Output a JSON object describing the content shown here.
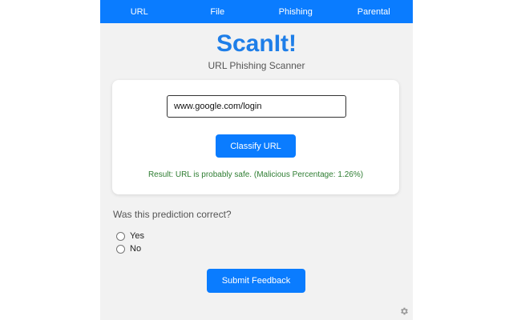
{
  "nav": {
    "items": [
      {
        "label": "URL"
      },
      {
        "label": "File"
      },
      {
        "label": "Phishing"
      },
      {
        "label": "Parental"
      }
    ]
  },
  "header": {
    "title": "ScanIt!",
    "subtitle": "URL Phishing Scanner"
  },
  "scanner": {
    "url_value": "www.google.com/login",
    "classify_label": "Classify URL",
    "result_text": "Result: URL is probably safe. (Malicious Percentage: 1.26%)"
  },
  "feedback": {
    "question": "Was this prediction correct?",
    "options": [
      {
        "label": "Yes"
      },
      {
        "label": "No"
      }
    ],
    "submit_label": "Submit Feedback"
  },
  "footer": {
    "settings_icon": "gear-icon"
  },
  "colors": {
    "accent": "#0a7cff",
    "title": "#1e7ee8",
    "result": "#2e7d32",
    "background": "#f2f2f2"
  }
}
